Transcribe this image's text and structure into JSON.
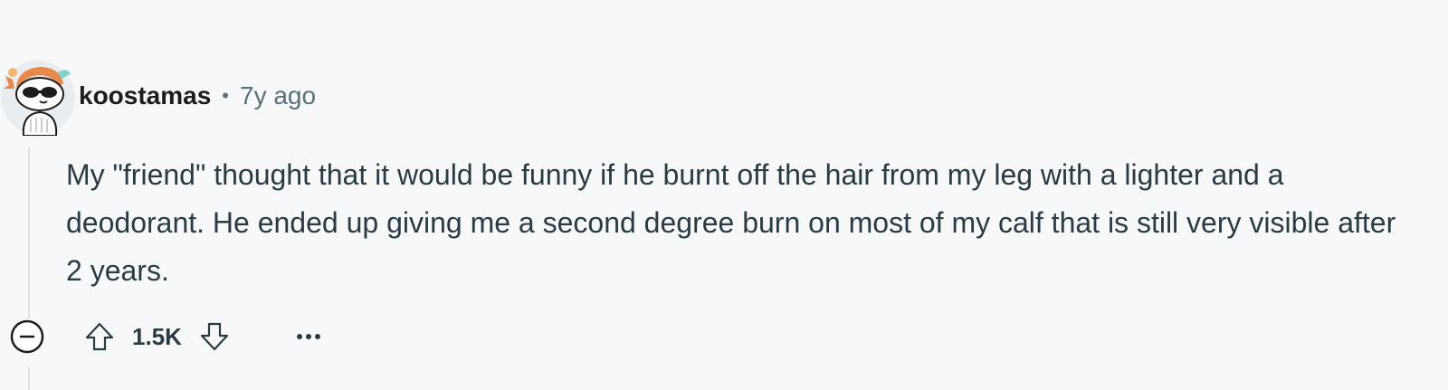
{
  "comment": {
    "author": "koostamas",
    "separator": "•",
    "time_ago": "7y ago",
    "body": "My \"friend\" thought that it would be funny if he burnt off the hair from my leg with a lighter and a deodorant. He ended up giving me a second degree burn on most of my calf that is still very visible after 2 years.",
    "score": "1.5K",
    "more_label": "•••"
  },
  "icons": {
    "avatar": "snoo-avatar-sunglasses",
    "collapse": "minus-circle-icon",
    "upvote": "upvote-arrow-icon",
    "downvote": "downvote-arrow-icon",
    "more": "more-options-icon"
  },
  "colors": {
    "background": "#f7f8fa",
    "meta_text": "#576f76",
    "body_text": "#2a3c42",
    "thread_line": "#dfe3e8"
  }
}
